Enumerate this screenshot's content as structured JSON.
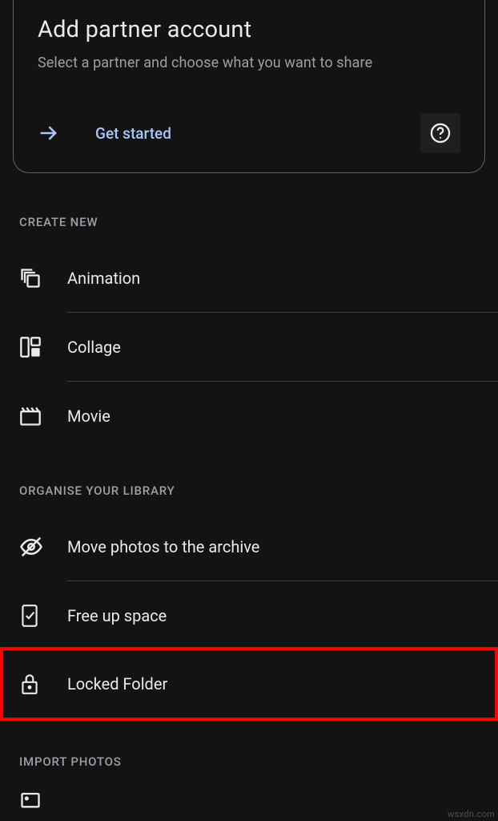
{
  "card": {
    "title": "Add partner account",
    "subtitle": "Select a partner and choose what you want to share",
    "action": "Get started"
  },
  "sections": {
    "create": {
      "header": "CREATE NEW",
      "items": {
        "animation": "Animation",
        "collage": "Collage",
        "movie": "Movie"
      }
    },
    "organise": {
      "header": "ORGANISE YOUR LIBRARY",
      "items": {
        "archive": "Move photos to the archive",
        "free_space": "Free up space",
        "locked_folder": "Locked Folder"
      }
    },
    "import": {
      "header": "IMPORT PHOTOS"
    }
  },
  "watermark": "wsxdn.com"
}
